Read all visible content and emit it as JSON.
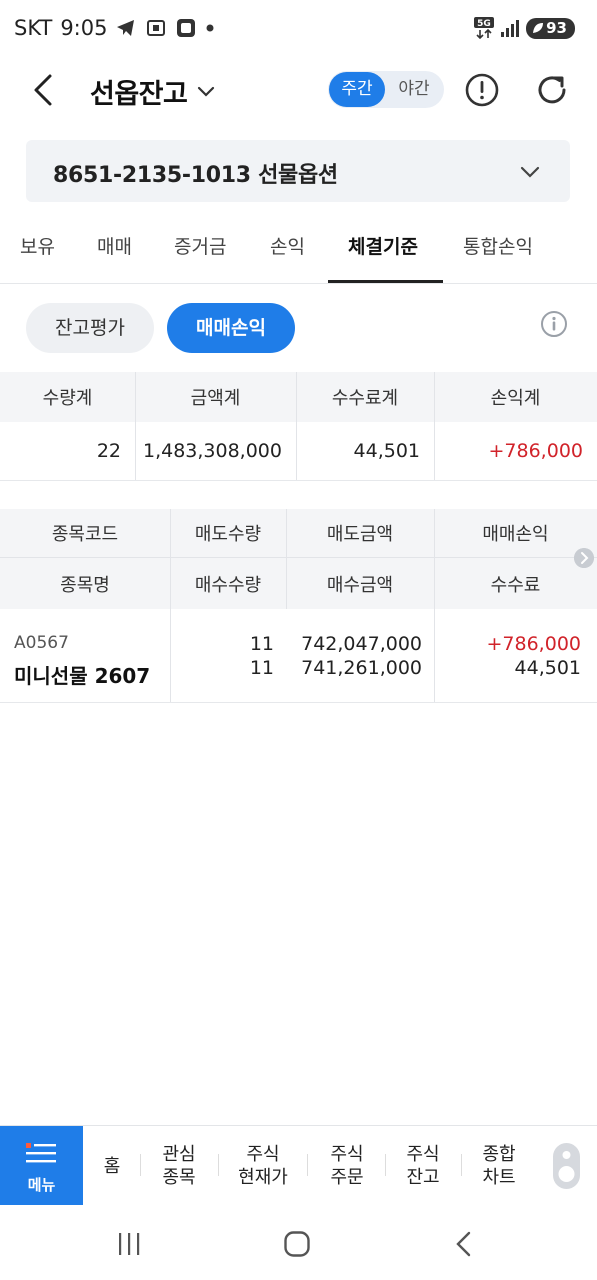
{
  "status_bar": {
    "carrier": "SKT",
    "time": "9:05",
    "network": "5G",
    "battery": "93"
  },
  "header": {
    "title": "선옵잔고",
    "toggle_day": "주간",
    "toggle_night": "야간"
  },
  "account": {
    "label": "8651-2135-1013 선물옵션"
  },
  "tabs": [
    {
      "label": "보유"
    },
    {
      "label": "매매"
    },
    {
      "label": "증거금"
    },
    {
      "label": "손익"
    },
    {
      "label": "체결기준"
    },
    {
      "label": "통합손익"
    }
  ],
  "pills": {
    "balance_eval": "잔고평가",
    "trade_pnl": "매매손익"
  },
  "summary": {
    "headers": [
      "수량계",
      "금액계",
      "수수료계",
      "손익계"
    ],
    "values": [
      "22",
      "1,483,308,000",
      "44,501",
      "+786,000"
    ]
  },
  "detail": {
    "headers_row1": [
      "종목코드",
      "매도수량",
      "매도금액",
      "매매손익"
    ],
    "headers_row2": [
      "종목명",
      "매수수량",
      "매수금액",
      "수수료"
    ],
    "rows": [
      {
        "code": "A0567",
        "name": "미니선물 2607",
        "sell_qty": "11",
        "buy_qty": "11",
        "sell_amount": "742,047,000",
        "buy_amount": "741,261,000",
        "pnl": "+786,000",
        "fee": "44,501"
      }
    ]
  },
  "bottom_nav": {
    "menu": "메뉴",
    "items": [
      {
        "line1": "홈",
        "line2": ""
      },
      {
        "line1": "관심",
        "line2": "종목"
      },
      {
        "line1": "주식",
        "line2": "현재가"
      },
      {
        "line1": "주식",
        "line2": "주문"
      },
      {
        "line1": "주식",
        "line2": "잔고"
      },
      {
        "line1": "종합",
        "line2": "차트"
      }
    ]
  },
  "colors": {
    "accent": "#1f7de8",
    "profit": "#d1232a"
  }
}
